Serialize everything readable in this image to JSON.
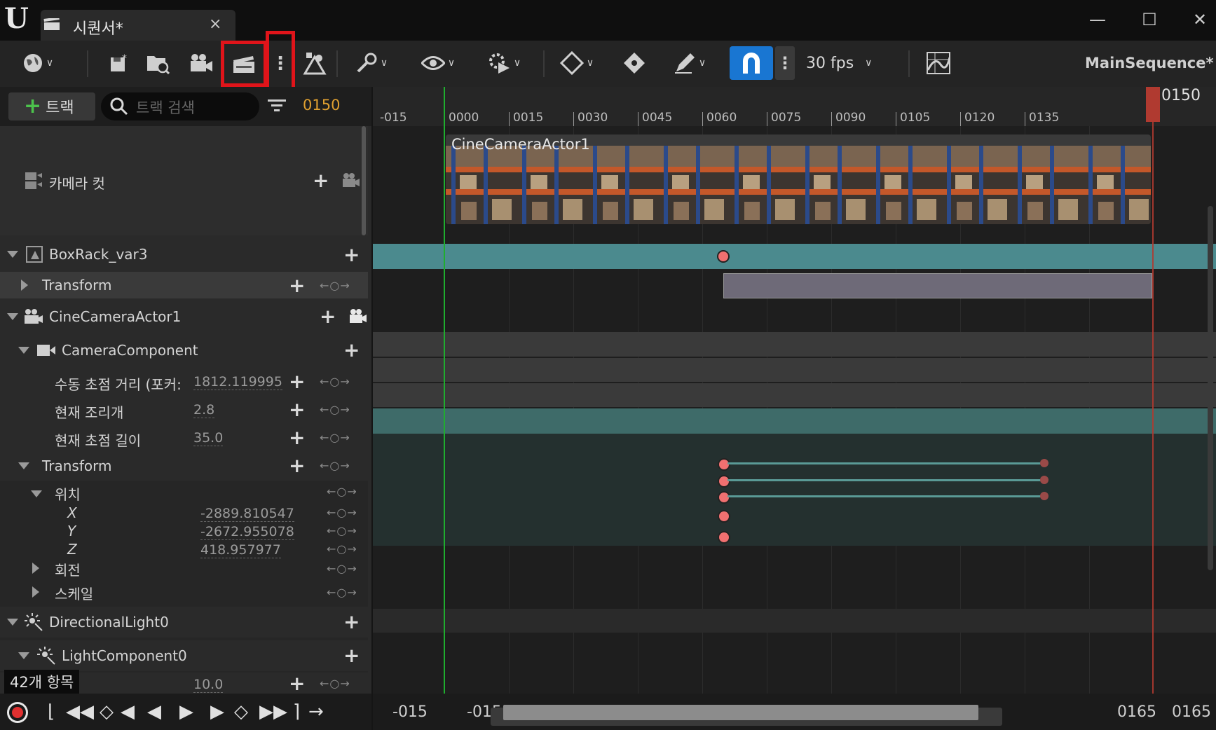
{
  "window": {
    "tab_title": "시퀀서*",
    "tab_close": "×",
    "minimize": "—",
    "maximize": "☐",
    "close": "✕"
  },
  "toolbar": {
    "fps_label": "30 fps",
    "sequence_name": "MainSequence*",
    "more_options": "⋮",
    "snap_more": "⋮"
  },
  "track_header": {
    "add_track_label": "트랙",
    "search_placeholder": "트랙 검색",
    "current_frame": "0150"
  },
  "outliner": {
    "camera_cuts": "카메라 컷",
    "tracks": [
      {
        "label": "BoxRack_var3"
      },
      {
        "label": "Transform"
      },
      {
        "label": "CineCameraActor1"
      },
      {
        "label": "CameraComponent"
      },
      {
        "label": "수동 초점 거리 (포커:",
        "value": "1812.119995"
      },
      {
        "label": "현재 조리개",
        "value": "2.8"
      },
      {
        "label": "현재 초점 길이",
        "value": "35.0"
      },
      {
        "label": "Transform"
      },
      {
        "label": "위치"
      },
      {
        "label": "X",
        "value": "-2889.810547"
      },
      {
        "label": "Y",
        "value": "-2672.955078"
      },
      {
        "label": "Z",
        "value": "418.957977"
      },
      {
        "label": "회전"
      },
      {
        "label": "스케일"
      },
      {
        "label": "DirectionalLight0"
      },
      {
        "label": "LightComponent0"
      },
      {
        "label": "",
        "value": "10.0"
      }
    ],
    "item_count": "42개 항목",
    "key_nav": "←○→"
  },
  "timeline": {
    "ruler_labels": [
      "-015",
      "0000",
      "0015",
      "0030",
      "0045",
      "0060",
      "0075",
      "0090",
      "0105",
      "0120",
      "0135"
    ],
    "playhead_label": "0150",
    "shot_label": "CineCameraActor1"
  },
  "transport": {
    "range_labels": [
      "-015",
      "-015",
      "0165",
      "0165"
    ]
  },
  "colors": {
    "accent_blue": "#1976d2",
    "highlight_red": "#e0141a",
    "current_frame": "#e0a030",
    "playhead": "#b03a30",
    "start_marker": "#1fae2e",
    "key": "#f07070"
  }
}
